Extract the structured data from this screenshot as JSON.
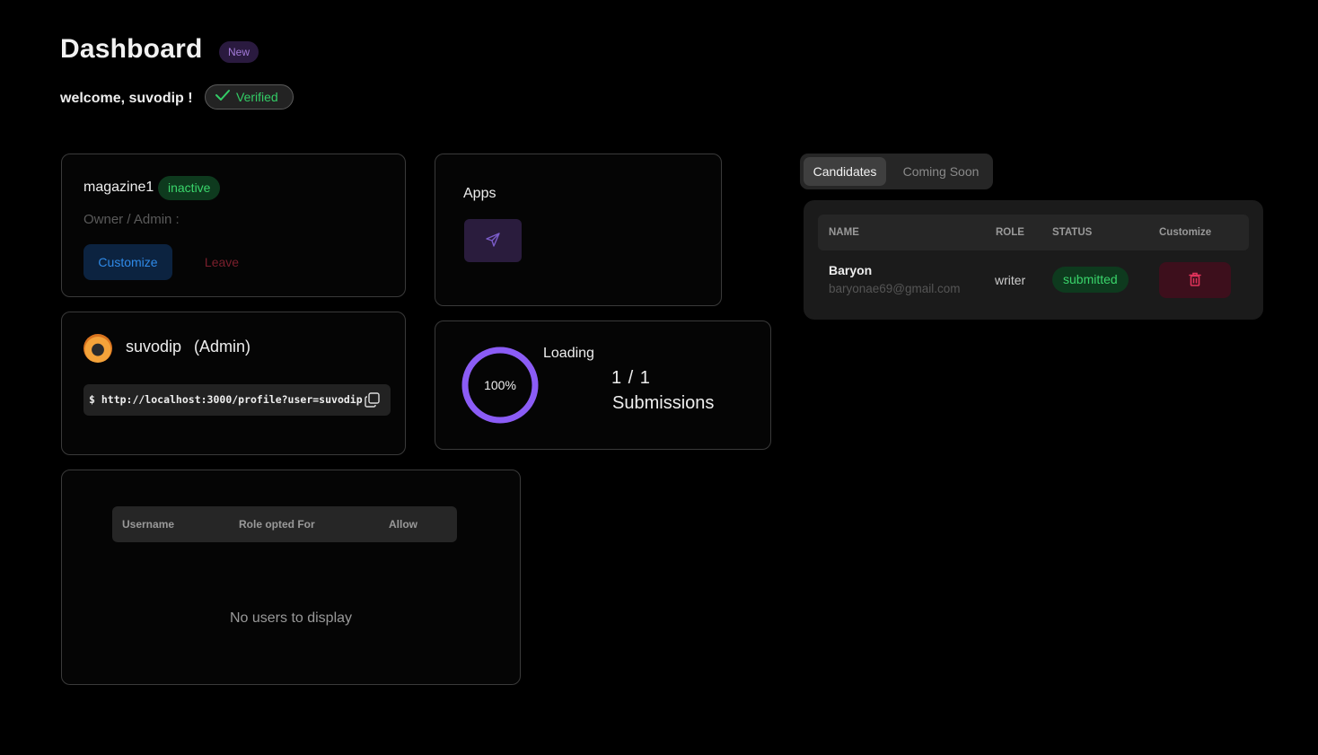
{
  "header": {
    "title": "Dashboard",
    "new_badge": "New",
    "welcome": "welcome, suvodip !",
    "verified_badge": "Verified"
  },
  "magazine_card": {
    "name": "magazine1",
    "status": "inactive",
    "owner_label": "Owner / Admin :",
    "customize_label": "Customize",
    "leave_label": "Leave"
  },
  "apps_card": {
    "title": "Apps",
    "app_icon": "send-icon"
  },
  "profile_card": {
    "name": "suvodip",
    "role": "(Admin)",
    "url": "$ http://localhost:3000/profile?user=suvodip",
    "copy_icon": "copy-icon"
  },
  "loading_card": {
    "progress": 1.0,
    "percent_label": "100%",
    "loading_label": "Loading",
    "count": "1 / 1",
    "submissions_label": "Submissions",
    "ring_color": "#8b5cf6"
  },
  "users_table": {
    "columns": [
      "Username",
      "Role opted For",
      "Allow"
    ],
    "empty_message": "No users to display"
  },
  "candidates": {
    "tabs": [
      "Candidates",
      "Coming Soon"
    ],
    "active_tab": "Candidates",
    "columns": [
      "NAME",
      "ROLE",
      "STATUS",
      "Customize"
    ],
    "rows": [
      {
        "name": "Baryon",
        "email": "baryonae69@gmail.com",
        "role": "writer",
        "status": "submitted",
        "action_icon": "trash-icon"
      }
    ]
  },
  "colors": {
    "background": "#000000",
    "accent_purple": "#8b5cf6",
    "success_green": "#3ad56b",
    "danger_red": "#e0335a",
    "primary_blue": "#2f8ae8"
  }
}
